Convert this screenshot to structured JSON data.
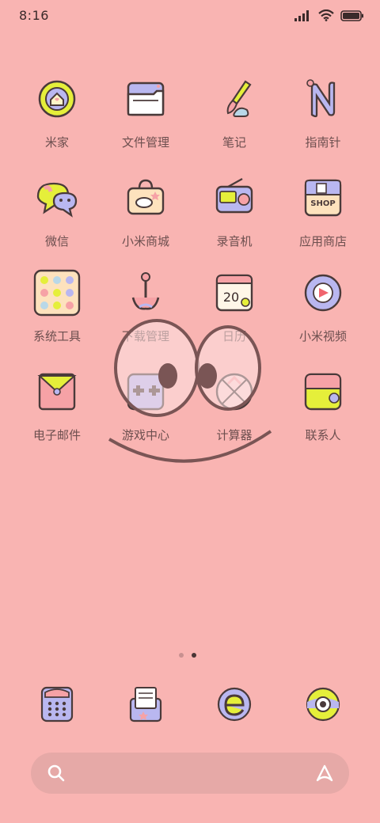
{
  "status_bar": {
    "time": "8:16"
  },
  "apps": [
    {
      "label": "米家",
      "icon": "mijia-home-icon"
    },
    {
      "label": "文件管理",
      "icon": "file-manager-icon"
    },
    {
      "label": "笔记",
      "icon": "notes-brush-icon"
    },
    {
      "label": "指南针",
      "icon": "compass-n-icon"
    },
    {
      "label": "微信",
      "icon": "wechat-bubbles-icon"
    },
    {
      "label": "小米商城",
      "icon": "mi-store-bag-icon"
    },
    {
      "label": "录音机",
      "icon": "recorder-radio-icon"
    },
    {
      "label": "应用商店",
      "icon": "app-store-shop-icon"
    },
    {
      "label": "系统工具",
      "icon": "system-tools-folder-icon"
    },
    {
      "label": "下载管理",
      "icon": "download-anchor-icon"
    },
    {
      "label": "日历",
      "icon": "calendar-icon",
      "badge": "20"
    },
    {
      "label": "小米视频",
      "icon": "mi-video-play-icon"
    },
    {
      "label": "电子邮件",
      "icon": "email-envelope-icon"
    },
    {
      "label": "游戏中心",
      "icon": "game-center-controller-icon"
    },
    {
      "label": "计算器",
      "icon": "calculator-icon"
    },
    {
      "label": "联系人",
      "icon": "contacts-icon"
    }
  ],
  "page_indicator": {
    "count": 2,
    "active": 2
  },
  "dock": [
    {
      "name": "phone-dialer-icon"
    },
    {
      "name": "messages-envelope-icon"
    },
    {
      "name": "browser-e-icon"
    },
    {
      "name": "camera-lens-icon"
    }
  ],
  "search": {
    "placeholder": ""
  },
  "colors": {
    "background": "#f9b4b2",
    "lavender": "#b9b7f0",
    "yellow": "#e5ef3a",
    "pink": "#f6a2a6"
  }
}
